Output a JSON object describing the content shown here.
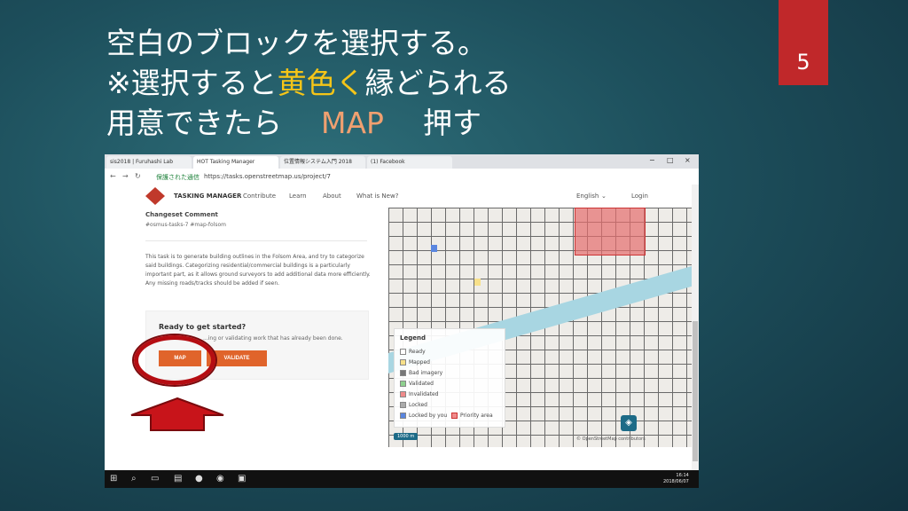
{
  "slide": {
    "title_line1": "空白のブロックを選択する。",
    "title_line2_a": "※選択すると",
    "title_line2_b": "黄色く",
    "title_line2_c": "縁どられる",
    "title_line3_a": "用意できたら",
    "title_line3_b": "MAP",
    "title_line3_c": "押す",
    "slide_number": "5",
    "accent_color": "#f5c518",
    "badge_color": "#c0282a"
  },
  "browser": {
    "tabs": [
      "sis2018 | Furuhashi Lab",
      "HOT Tasking Manager",
      "位置情報システム入門 2018",
      "(1) Facebook"
    ],
    "window_controls": [
      "−",
      "□",
      "×"
    ],
    "secure_label": "保護された通信",
    "url": "https://tasks.openstreetmap.us/project/7"
  },
  "header": {
    "logo_text": "TASKING MANAGER",
    "nav": [
      "Contribute",
      "Learn",
      "About",
      "What is New?"
    ],
    "language": "English",
    "login": "Login"
  },
  "left": {
    "changeset_title": "Changeset Comment",
    "changeset_tags": "#osmus-tasks-7 #map-folsom",
    "description": "This task is to generate building outlines in the Folsom Area, and try to categorize said buildings. Categorizing residential/commercial buildings is a particularly important part, as it allows ground surveyors to add additional data more efficiently. Any missing roads/tracks should be added if seen.",
    "ready_title": "Ready to get started?",
    "ready_sub": "...ing or validating work that has already been done.",
    "map_button": "MAP",
    "validate_button": "VALIDATE"
  },
  "legend": {
    "title": "Legend",
    "items": [
      {
        "label": "Ready",
        "color": "#ffffff"
      },
      {
        "label": "Mapped",
        "color": "#f7e08a"
      },
      {
        "label": "Bad imagery",
        "color": "#777777"
      },
      {
        "label": "Validated",
        "color": "#8fd08f"
      },
      {
        "label": "Invalidated",
        "color": "#ef8a8a"
      },
      {
        "label": "Locked",
        "color": "#aaaaaa"
      },
      {
        "label": "Locked by you",
        "color": "#5a86e0"
      }
    ],
    "priority_label": "Priority area",
    "scale": "1000 m",
    "attribution": "© OpenStreetMap contributors"
  },
  "taskbar": {
    "time": "16:14",
    "date": "2018/06/07"
  }
}
